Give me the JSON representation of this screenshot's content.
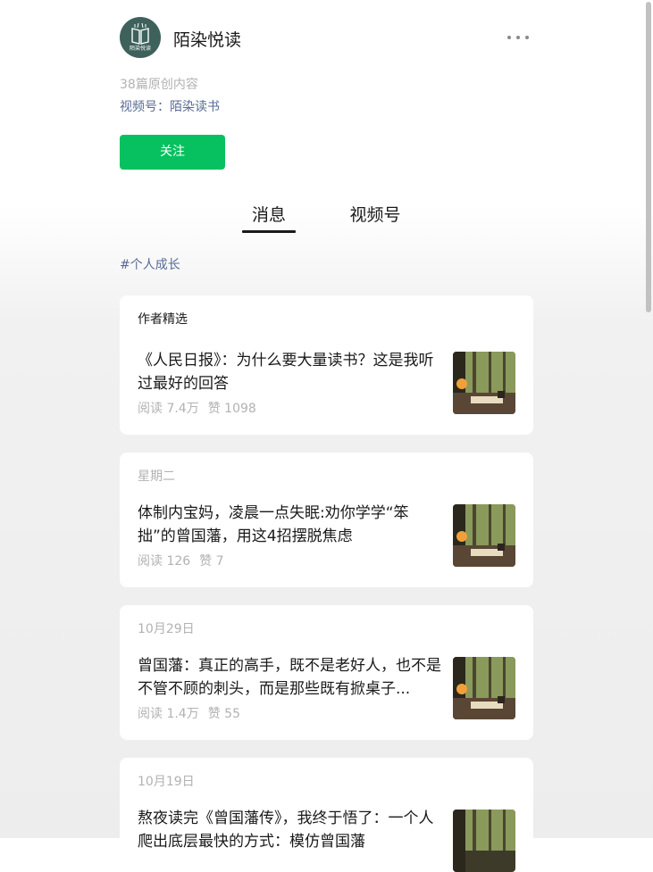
{
  "account": {
    "name": "陌染悦读",
    "avatar_text": "陌染悦读",
    "original_count": "38篇原创内容",
    "video_account": "视频号：陌染读书",
    "follow_label": "关注",
    "more_icon": "more-dots-icon"
  },
  "tabs": [
    {
      "label": "消息",
      "active": true
    },
    {
      "label": "视频号",
      "active": false
    }
  ],
  "hashtag": "#个人成长",
  "cards": [
    {
      "label": "作者精选",
      "title": "《人民日报》：为什么要大量读书？这是我听过最好的回答",
      "reads": "阅读 7.4万",
      "likes": "赞 1098"
    },
    {
      "label": "星期二",
      "title": "体制内宝妈，凌晨一点失眠:劝你学学“笨拙”的曾国藩，用这4招摆脱焦虑",
      "reads": "阅读 126",
      "likes": "赞 7"
    },
    {
      "label": "10月29日",
      "title": "曾国藩：真正的高手，既不是老好人，也不是不管不顾的刺头，而是那些既有掀桌子...",
      "reads": "阅读 1.4万",
      "likes": "赞 55"
    },
    {
      "label": "10月19日",
      "title": "熬夜读完《曾国藩传》，我终于悟了：一个人爬出底层最快的方式：模仿曾国藩",
      "reads": "",
      "likes": ""
    }
  ],
  "colors": {
    "accent_green": "#07c160",
    "link_blue": "#576b95",
    "muted_gray": "#b2b2b2"
  }
}
